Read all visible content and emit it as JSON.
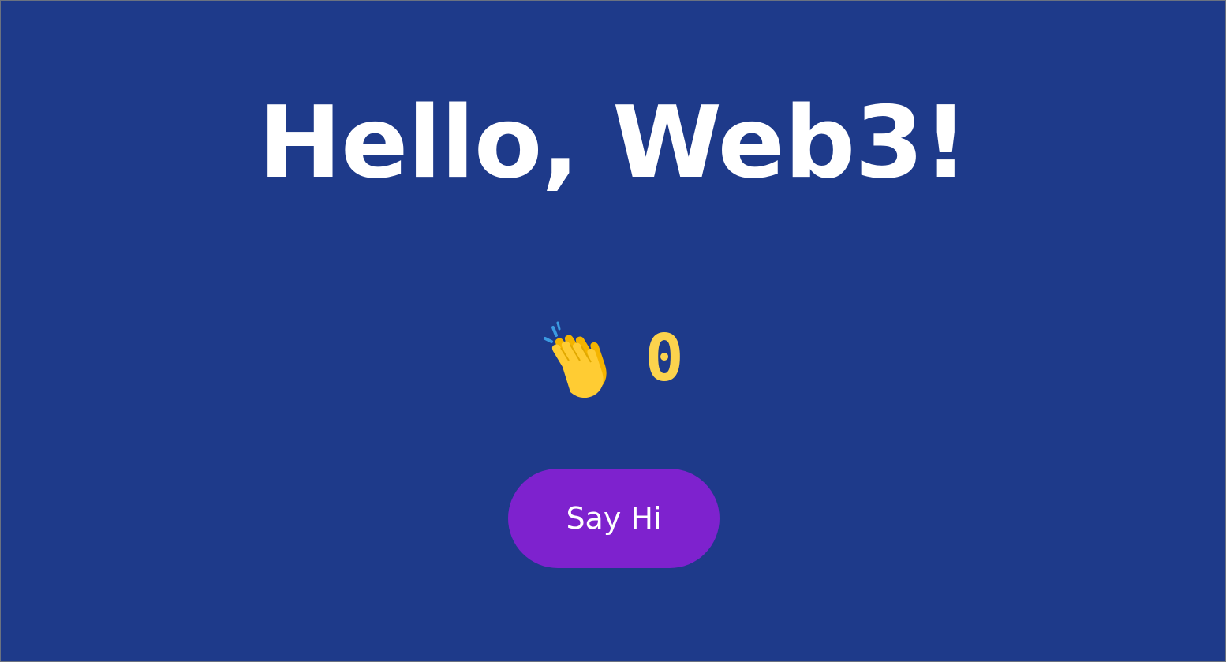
{
  "header": {
    "title": "Hello, Web3!"
  },
  "counter": {
    "icon": "clapping-hands-icon",
    "count": "0"
  },
  "actions": {
    "say_hi_label": "Say Hi"
  },
  "colors": {
    "background": "#1e3a8a",
    "title": "#ffffff",
    "count": "#fcd34d",
    "button": "#7e22ce",
    "button_text": "#ffffff"
  }
}
